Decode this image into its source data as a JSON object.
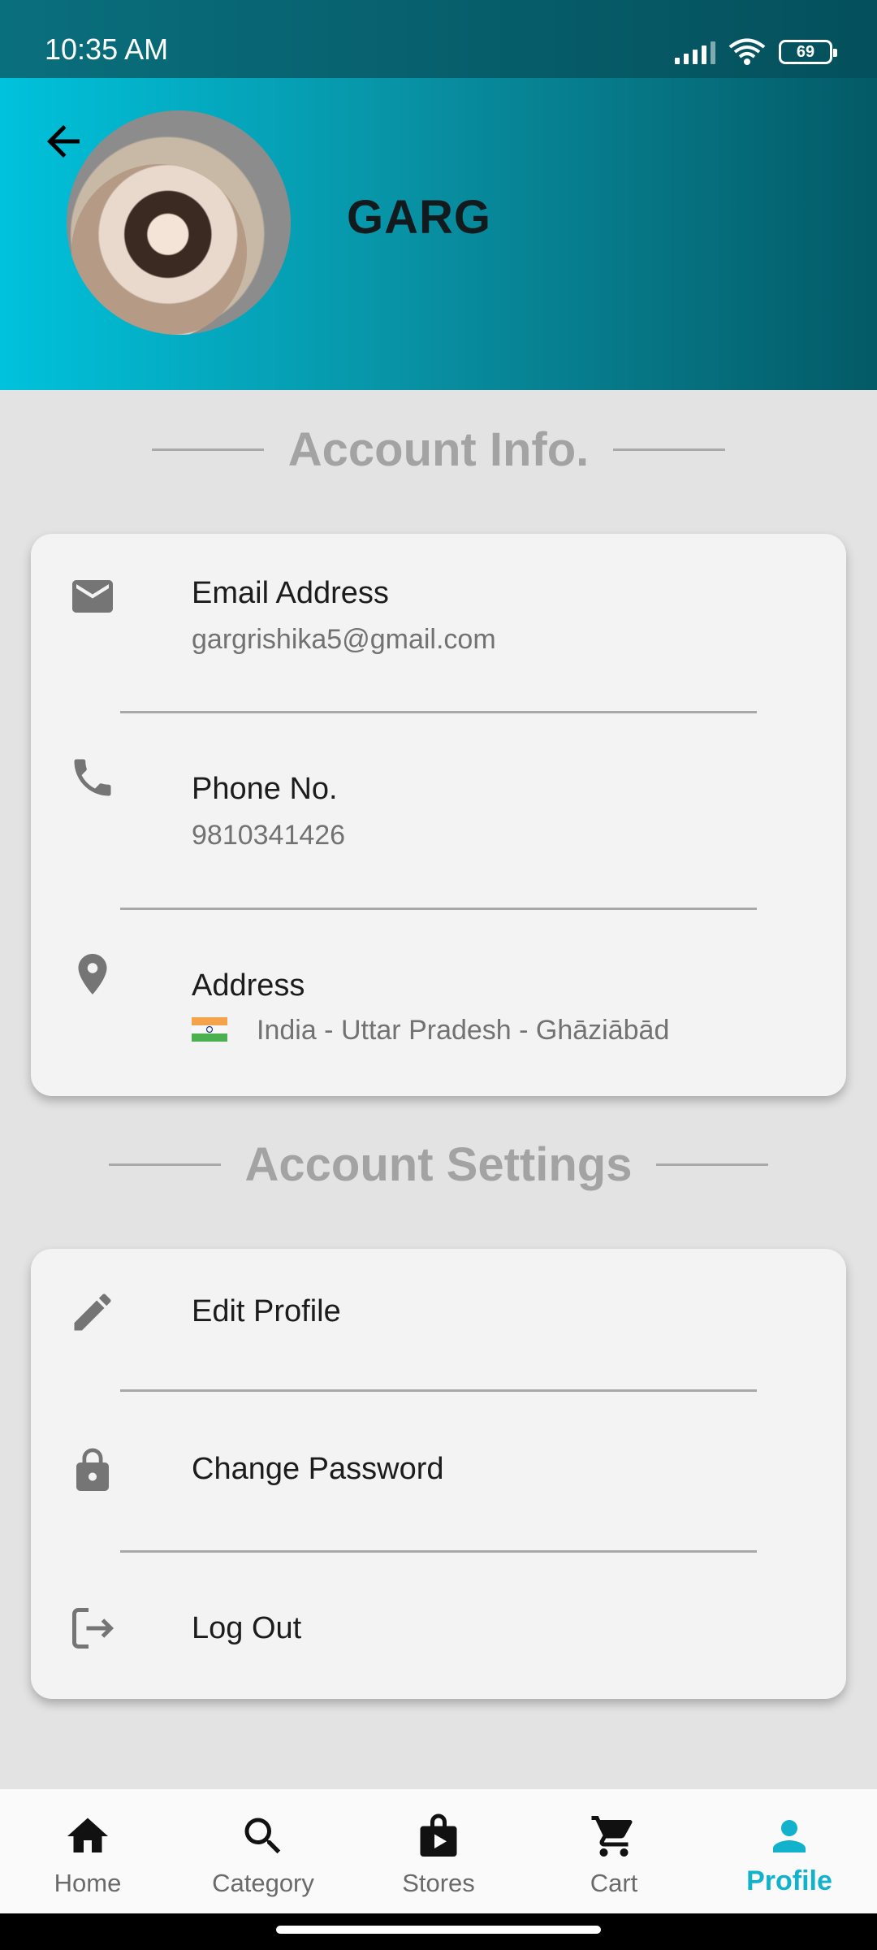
{
  "status_bar": {
    "time": "10:35 AM",
    "battery": "69"
  },
  "header": {
    "user_name": "GARG"
  },
  "account_info": {
    "title": "Account Info.",
    "rows": [
      {
        "label": "Email Address",
        "value": "gargrishika5@gmail.com",
        "icon": "email-icon"
      },
      {
        "label": "Phone No.",
        "value": "9810341426",
        "icon": "phone-icon"
      },
      {
        "label": "Address",
        "value": "India - Uttar Pradesh - Ghāziābād",
        "icon": "location-pin-icon"
      }
    ]
  },
  "account_settings": {
    "title": "Account Settings",
    "items": [
      {
        "label": "Edit Profile",
        "icon": "pencil-icon"
      },
      {
        "label": "Change Password",
        "icon": "lock-icon"
      },
      {
        "label": "Log Out",
        "icon": "logout-icon"
      }
    ]
  },
  "bottom_nav": {
    "items": [
      {
        "label": "Home",
        "icon": "home-icon"
      },
      {
        "label": "Category",
        "icon": "search-icon"
      },
      {
        "label": "Stores",
        "icon": "store-bag-icon"
      },
      {
        "label": "Cart",
        "icon": "cart-icon"
      },
      {
        "label": "Profile",
        "icon": "person-icon",
        "active": true
      }
    ]
  },
  "colors": {
    "accent": "#12b2cc",
    "header_start": "#00c2dc",
    "header_end": "#045a66"
  }
}
